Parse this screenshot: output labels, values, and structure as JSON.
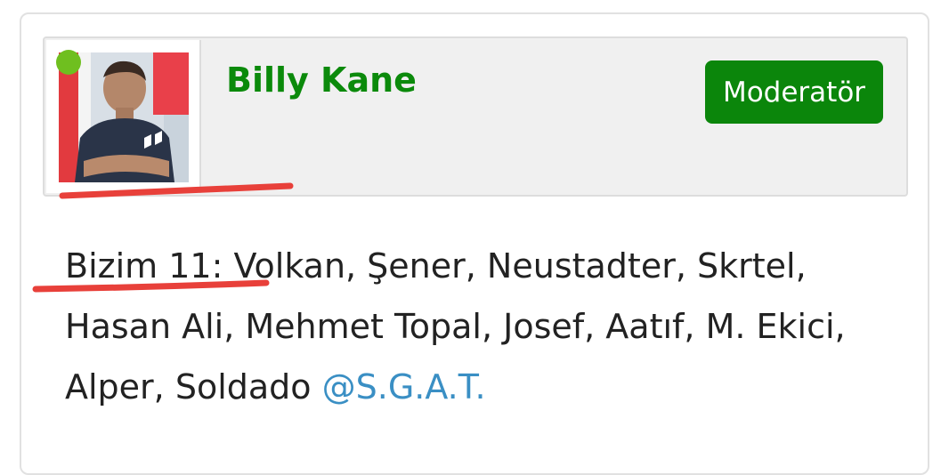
{
  "user": {
    "name": "Billy Kane",
    "role": "Moderatör",
    "online": true
  },
  "post": {
    "text": "Bizim 11: Volkan, Şener, Neustadter, Skrtel, Hasan Ali, Mehmet Topal, Josef, Aatıf, M. Ekici, Alper, Soldado ",
    "mention": "@S.G.A.T."
  },
  "colors": {
    "username": "#0b8a0b",
    "badge_bg": "#0b860b",
    "online": "#6fbf1f",
    "mention": "#3a8fc4",
    "annotation": "#e8403a"
  }
}
